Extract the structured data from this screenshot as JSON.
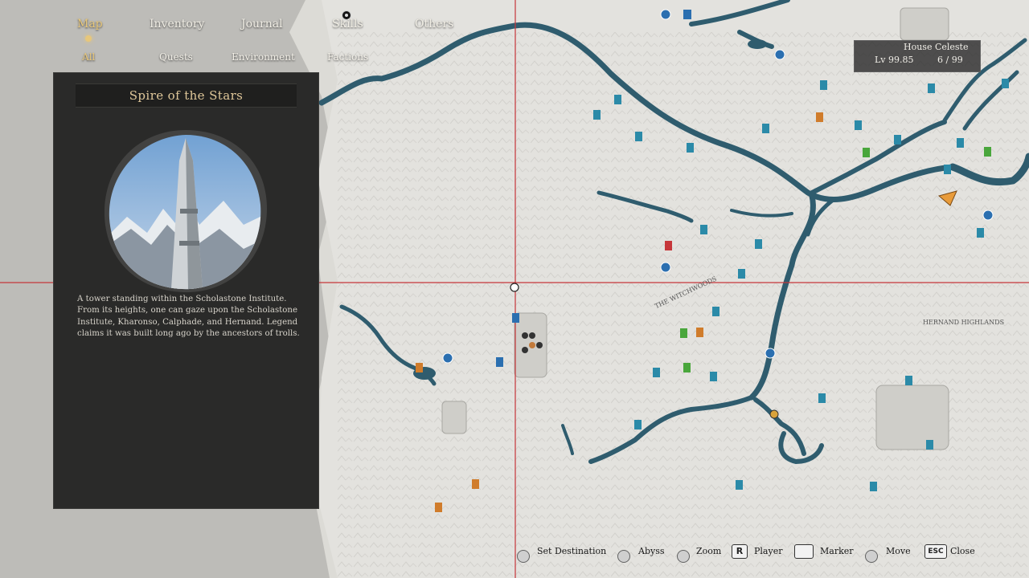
{
  "nav": {
    "top": [
      {
        "label": "Map",
        "active": true
      },
      {
        "label": "Inventory",
        "active": false
      },
      {
        "label": "Journal",
        "active": false
      },
      {
        "label": "Skills",
        "active": false
      },
      {
        "label": "Others",
        "active": false
      }
    ],
    "sub": [
      {
        "label": "All",
        "active": true
      },
      {
        "label": "Quests",
        "active": false
      },
      {
        "label": "Environment",
        "active": false
      },
      {
        "label": "Factions",
        "active": false
      }
    ]
  },
  "panel": {
    "title": "Spire of the Stars",
    "description_lines": [
      "A tower standing within the Scholastone Institute.",
      "From its heights, one can gaze upon the Scholastone",
      "Institute, Kharonso, Calphade, and Hernand. Legend",
      "claims it was built long ago by the ancestors of trolls."
    ]
  },
  "map": {
    "labels": [
      {
        "text": "THE WITCHWOODS"
      },
      {
        "text": "HERNAND HIGHLANDS"
      }
    ]
  },
  "house": {
    "name": "House  Celeste",
    "level": "Lv 99.85",
    "members": "6  /  99"
  },
  "footer": {
    "hints": [
      {
        "label": "Set Destination",
        "icon": "mouse-left-icon"
      },
      {
        "label": "Abyss",
        "icon": "mouse-wheel-icon"
      },
      {
        "label": "Zoom",
        "icon": "scroll-icon"
      },
      {
        "label": "Player",
        "key": "R"
      },
      {
        "label": "Marker",
        "icon": "space-key-icon"
      },
      {
        "label": "Move",
        "icon": "dpad-icon"
      },
      {
        "label": "Close",
        "key": "ESC"
      }
    ]
  },
  "colors": {
    "water": "#2f5c6e",
    "land": "#e3e2de",
    "panel_bg": "#2a2a29",
    "accent": "#e7c77b",
    "crosshair": "#c6363a"
  }
}
